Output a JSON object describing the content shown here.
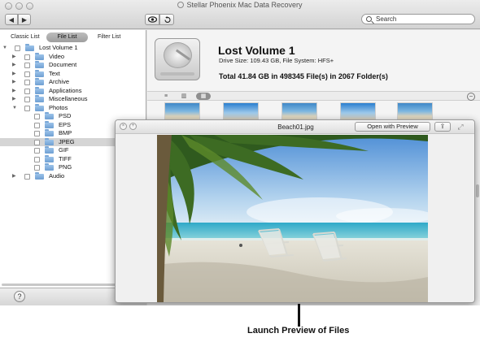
{
  "window": {
    "title": "Stellar Phoenix Mac Data Recovery",
    "back_icon": "back-arrow-icon",
    "forward_icon": "forward-arrow-icon",
    "preview_icon": "eye-icon",
    "recover_icon": "undo-icon",
    "search_placeholder": "Search"
  },
  "sidebar": {
    "tabs": [
      {
        "label": "Classic List",
        "active": false
      },
      {
        "label": "File List",
        "active": true
      },
      {
        "label": "Filter List",
        "active": false
      }
    ],
    "tree": [
      {
        "label": "Lost Volume 1",
        "level": 0,
        "expanded": true,
        "selected": false
      },
      {
        "label": "Video",
        "level": 1,
        "expanded": false,
        "selected": false
      },
      {
        "label": "Document",
        "level": 1,
        "expanded": false,
        "selected": false
      },
      {
        "label": "Text",
        "level": 1,
        "expanded": false,
        "selected": false
      },
      {
        "label": "Archive",
        "level": 1,
        "expanded": false,
        "selected": false
      },
      {
        "label": "Applications",
        "level": 1,
        "expanded": false,
        "selected": false
      },
      {
        "label": "Miscellaneous",
        "level": 1,
        "expanded": false,
        "selected": false
      },
      {
        "label": "Photos",
        "level": 1,
        "expanded": true,
        "selected": false
      },
      {
        "label": "PSD",
        "level": 2,
        "expanded": null,
        "selected": false
      },
      {
        "label": "EPS",
        "level": 2,
        "expanded": null,
        "selected": false
      },
      {
        "label": "BMP",
        "level": 2,
        "expanded": null,
        "selected": false
      },
      {
        "label": "JPEG",
        "level": 2,
        "expanded": null,
        "selected": true
      },
      {
        "label": "GIF",
        "level": 2,
        "expanded": null,
        "selected": false
      },
      {
        "label": "TIFF",
        "level": 2,
        "expanded": null,
        "selected": false
      },
      {
        "label": "PNG",
        "level": 2,
        "expanded": null,
        "selected": false
      },
      {
        "label": "Audio",
        "level": 1,
        "expanded": false,
        "selected": false
      }
    ],
    "help_label": "?"
  },
  "volume": {
    "name": "Lost Volume 1",
    "info": "Drive Size: 109.43 GB, File System: HFS+",
    "total": "Total 41.84 GB in 498345 File(s) in 2067 Folder(s)"
  },
  "viewbar": {
    "modes": [
      "list-view-icon",
      "column-view-icon",
      "icon-view-icon"
    ],
    "active_mode": 2,
    "zoom_out_label": "−"
  },
  "preview": {
    "filename": "Beach01.jpg",
    "open_button": "Open with Preview",
    "share_icon": "share-icon",
    "expand_icon": "expand-icon"
  },
  "caption": "Launch Preview of Files",
  "colors": {
    "selection": "#d5d5d5",
    "folder": "#7aa8d8",
    "toolbar": "#d3d3d3"
  }
}
